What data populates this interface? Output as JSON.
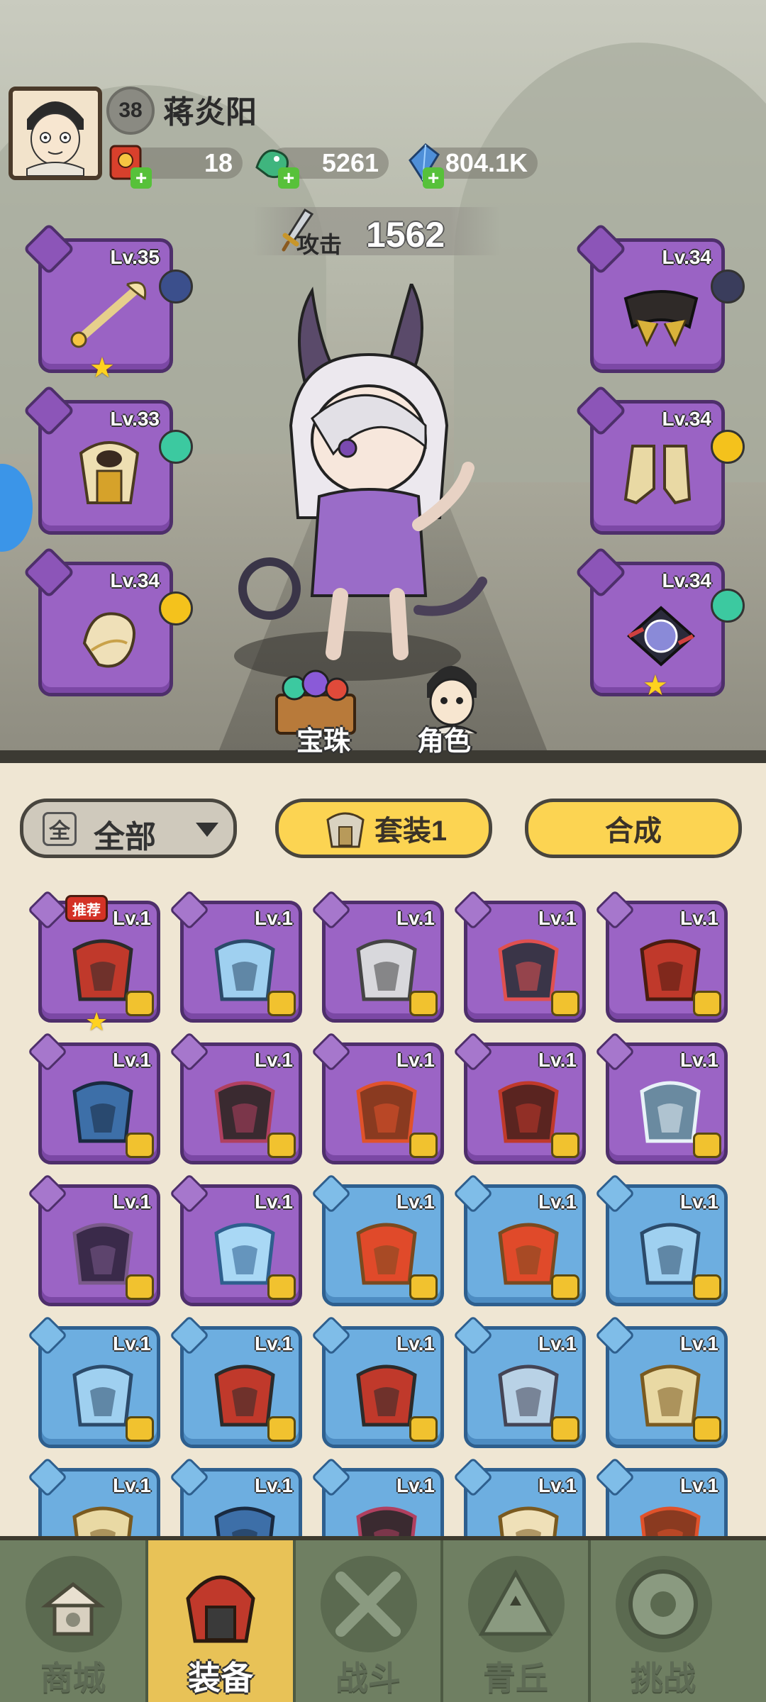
{
  "player": {
    "level": "38",
    "name": "蒋炎阳"
  },
  "resources": [
    {
      "icon": "red-envelope-icon",
      "value": "18"
    },
    {
      "icon": "jade-dragon-icon",
      "value": "5261"
    },
    {
      "icon": "crystal-icon",
      "value": "804.1K"
    }
  ],
  "attack": {
    "label": "攻击",
    "value": "1562"
  },
  "equipped": {
    "left": [
      {
        "slot": "weapon",
        "level": "Lv.35",
        "gem_color": "#3b4f8c",
        "star": true
      },
      {
        "slot": "armor",
        "level": "Lv.33",
        "gem_color": "#3cc9a0",
        "star": false
      },
      {
        "slot": "ring",
        "level": "Lv.34",
        "gem_color": "#f4c21c",
        "star": false
      }
    ],
    "right": [
      {
        "slot": "belt",
        "level": "Lv.34",
        "gem_color": "#3a3d5c",
        "star": false
      },
      {
        "slot": "boots",
        "level": "Lv.34",
        "gem_color": "#f4c21c",
        "star": false
      },
      {
        "slot": "amulet",
        "level": "Lv.34",
        "gem_color": "#3cc9a0",
        "star": true
      }
    ]
  },
  "scene_tabs": {
    "gems": "宝珠",
    "character": "角色"
  },
  "toolbar": {
    "filter_icon": "全",
    "filter_label": "全部",
    "set_label": "套装1",
    "synth_label": "合成"
  },
  "recommend_badge": "推荐",
  "inventory": [
    {
      "rarity": "purple",
      "level": "Lv.1",
      "kind": "armor-red-helm",
      "recommended": true,
      "star": true
    },
    {
      "rarity": "purple",
      "level": "Lv.1",
      "kind": "bow",
      "recommended": false,
      "star": false
    },
    {
      "rarity": "purple",
      "level": "Lv.1",
      "kind": "anvil-weapon",
      "recommended": false,
      "star": false
    },
    {
      "rarity": "purple",
      "level": "Lv.1",
      "kind": "dark-armor",
      "recommended": false,
      "star": false
    },
    {
      "rarity": "purple",
      "level": "Lv.1",
      "kind": "red-ring",
      "recommended": false,
      "star": false
    },
    {
      "rarity": "purple",
      "level": "Lv.1",
      "kind": "blue-antler-ring",
      "recommended": false,
      "star": false
    },
    {
      "rarity": "purple",
      "level": "Lv.1",
      "kind": "dark-antler-ring",
      "recommended": false,
      "star": false
    },
    {
      "rarity": "purple",
      "level": "Lv.1",
      "kind": "lotus-belt",
      "recommended": false,
      "star": false
    },
    {
      "rarity": "purple",
      "level": "Lv.1",
      "kind": "red-boots",
      "recommended": false,
      "star": false
    },
    {
      "rarity": "purple",
      "level": "Lv.1",
      "kind": "ice-boots",
      "recommended": false,
      "star": false
    },
    {
      "rarity": "purple",
      "level": "Lv.1",
      "kind": "dark-boots",
      "recommended": false,
      "star": false
    },
    {
      "rarity": "purple",
      "level": "Lv.1",
      "kind": "crystal-amulet",
      "recommended": false,
      "star": false
    },
    {
      "rarity": "blue",
      "level": "Lv.1",
      "kind": "fire-staff",
      "recommended": false,
      "star": false
    },
    {
      "rarity": "blue",
      "level": "Lv.1",
      "kind": "fire-staff",
      "recommended": false,
      "star": false
    },
    {
      "rarity": "blue",
      "level": "Lv.1",
      "kind": "bow",
      "recommended": false,
      "star": false
    },
    {
      "rarity": "blue",
      "level": "Lv.1",
      "kind": "bow",
      "recommended": false,
      "star": false
    },
    {
      "rarity": "blue",
      "level": "Lv.1",
      "kind": "armor-red-helm",
      "recommended": false,
      "star": false
    },
    {
      "rarity": "blue",
      "level": "Lv.1",
      "kind": "armor-red-helm",
      "recommended": false,
      "star": false
    },
    {
      "rarity": "blue",
      "level": "Lv.1",
      "kind": "ice-armor",
      "recommended": false,
      "star": false
    },
    {
      "rarity": "blue",
      "level": "Lv.1",
      "kind": "gold-armor",
      "recommended": false,
      "star": false
    },
    {
      "rarity": "blue",
      "level": "Lv.1",
      "kind": "gold-armor",
      "recommended": false,
      "star": false
    },
    {
      "rarity": "blue",
      "level": "Lv.1",
      "kind": "blue-antler-ring",
      "recommended": false,
      "star": false
    },
    {
      "rarity": "blue",
      "level": "Lv.1",
      "kind": "dark-antler-ring",
      "recommended": false,
      "star": false
    },
    {
      "rarity": "blue",
      "level": "Lv.1",
      "kind": "gold-ring",
      "recommended": false,
      "star": false
    },
    {
      "rarity": "blue",
      "level": "Lv.1",
      "kind": "lotus-belt",
      "recommended": false,
      "star": false
    }
  ],
  "nav": [
    {
      "label": "商城",
      "icon": "shop-pagoda-icon",
      "active": false
    },
    {
      "label": "装备",
      "icon": "equipment-helmet-icon",
      "active": true
    },
    {
      "label": "战斗",
      "icon": "crossed-swords-icon",
      "active": false
    },
    {
      "label": "青丘",
      "icon": "mountain-icon",
      "active": false
    },
    {
      "label": "挑战",
      "icon": "challenge-disc-icon",
      "active": false
    }
  ]
}
